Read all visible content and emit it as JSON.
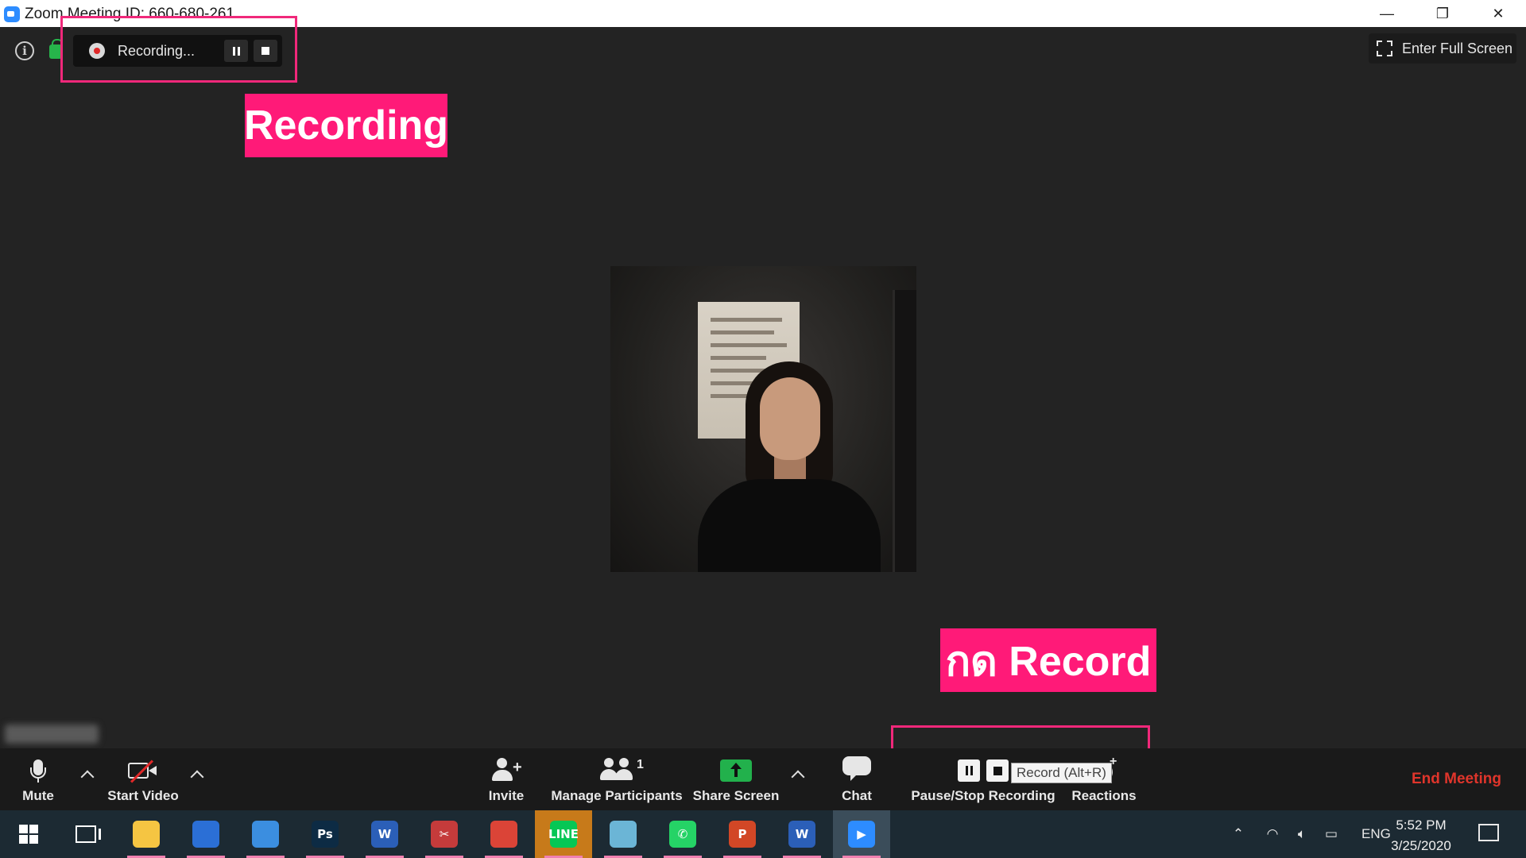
{
  "window": {
    "title": "Zoom Meeting ID: 660-680-261",
    "minimize_glyph": "—",
    "restore_glyph": "❐",
    "close_glyph": "✕"
  },
  "recording_bar": {
    "status": "Recording..."
  },
  "annotations": {
    "top_label": "Recording",
    "bottom_label": "กด Record",
    "color": "#ff1a78"
  },
  "fullscreen": {
    "label": "Enter Full Screen"
  },
  "toolbar": {
    "mute": "Mute",
    "start_video": "Start Video",
    "invite": "Invite",
    "manage_participants": "Manage Participants",
    "participant_count": "1",
    "share_screen": "Share Screen",
    "chat": "Chat",
    "pause_stop_recording": "Pause/Stop Recording",
    "reactions": "Reactions",
    "record_tooltip": "Record (Alt+R)",
    "end_meeting": "End Meeting",
    "end_color": "#e0352b",
    "share_color": "#22b14c"
  },
  "taskbar": {
    "apps": [
      {
        "name": "file-explorer",
        "glyph": "",
        "color": "#f5c542"
      },
      {
        "name": "microsoft-store",
        "glyph": "",
        "color": "#2b6fd6"
      },
      {
        "name": "mail",
        "glyph": "",
        "color": "#3b8ee0"
      },
      {
        "name": "photoshop",
        "glyph": "Ps",
        "color": "#0d2b44"
      },
      {
        "name": "word",
        "glyph": "W",
        "color": "#2b5fb8"
      },
      {
        "name": "snipping-tool",
        "glyph": "✂",
        "color": "#c53b3b"
      },
      {
        "name": "chrome",
        "glyph": "",
        "color": "#db4437"
      },
      {
        "name": "line",
        "glyph": "LINE",
        "color": "#06c755"
      },
      {
        "name": "notes",
        "glyph": "",
        "color": "#6bb5d6"
      },
      {
        "name": "whatsapp",
        "glyph": "✆",
        "color": "#25d366"
      },
      {
        "name": "powerpoint",
        "glyph": "P",
        "color": "#d24726"
      },
      {
        "name": "word-2",
        "glyph": "W",
        "color": "#2b5fb8"
      },
      {
        "name": "zoom",
        "glyph": "▶",
        "color": "#2d8cff"
      }
    ],
    "language": "ENG",
    "time": "5:52 PM",
    "date": "3/25/2020"
  }
}
